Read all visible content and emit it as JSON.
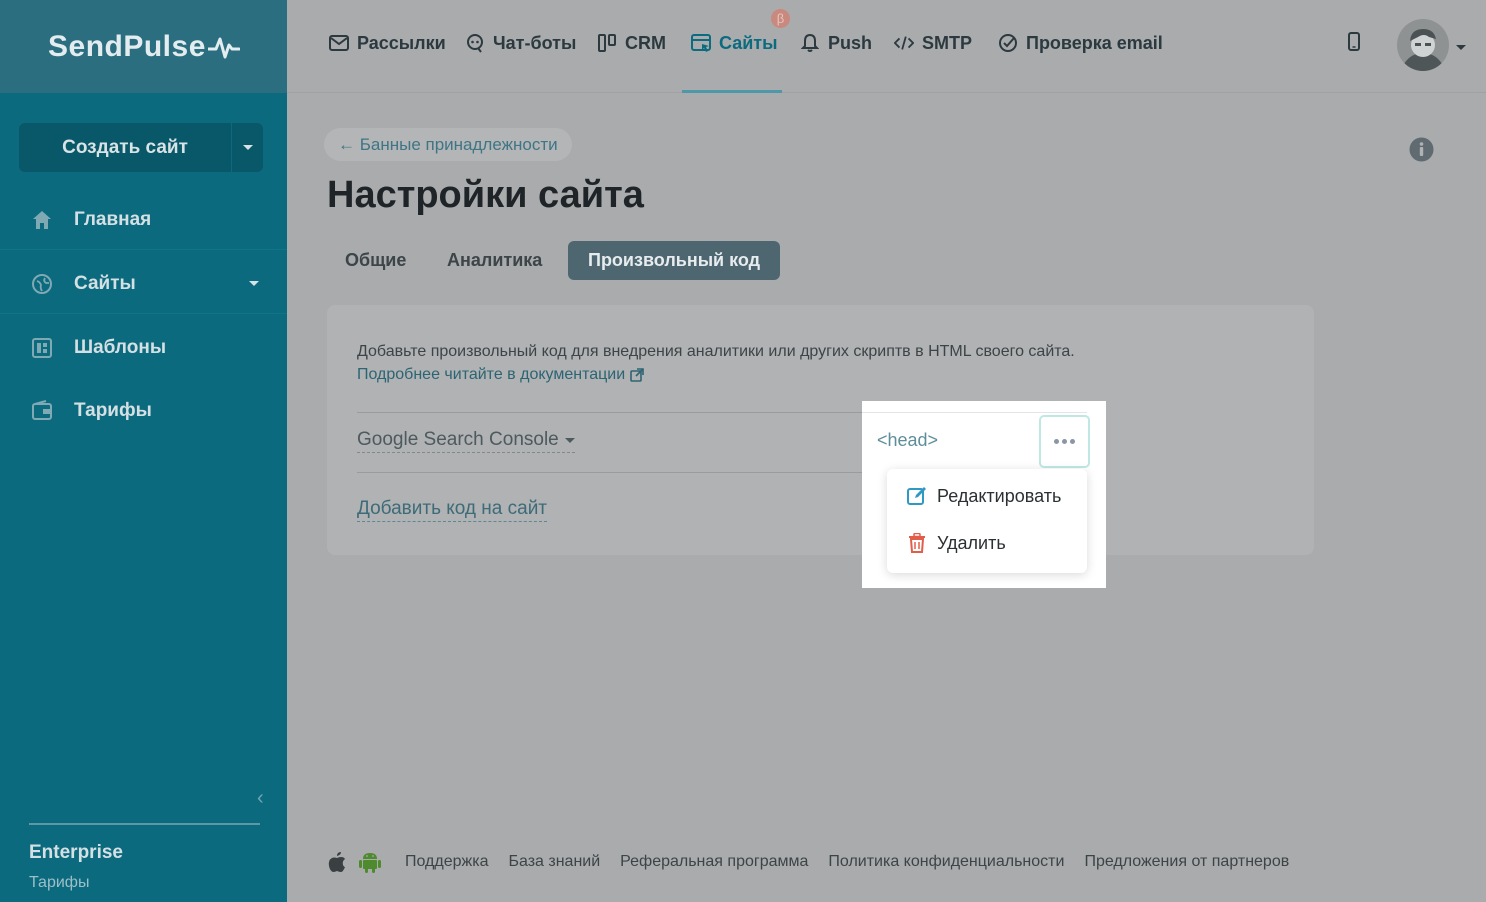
{
  "brand": {
    "name": "SendPulse"
  },
  "sidebar": {
    "create_button": "Создать сайт",
    "items": [
      {
        "label": "Главная",
        "icon": "home-icon"
      },
      {
        "label": "Сайты",
        "icon": "globe-icon"
      },
      {
        "label": "Шаблоны",
        "icon": "template-icon"
      },
      {
        "label": "Тарифы",
        "icon": "wallet-icon"
      }
    ],
    "plan_name": "Enterprise",
    "plan_link": "Тарифы"
  },
  "topnav": {
    "items": [
      {
        "label": "Рассылки",
        "icon": "mail-icon"
      },
      {
        "label": "Чат-боты",
        "icon": "chatbot-icon"
      },
      {
        "label": "CRM",
        "icon": "crm-icon"
      },
      {
        "label": "Сайты",
        "icon": "site-icon",
        "active": true
      },
      {
        "label": "Push",
        "icon": "bell-icon"
      },
      {
        "label": "SMTP",
        "icon": "code-icon"
      },
      {
        "label": "Проверка email",
        "icon": "check-circle-icon"
      }
    ],
    "beta_badge": "β"
  },
  "page": {
    "back_link": "← Банные принадлежности",
    "title": "Настройки сайта",
    "tabs": [
      "Общие",
      "Аналитика",
      "Произвольный код"
    ],
    "active_tab": "Произвольный код"
  },
  "custom_code": {
    "description": "Добавьте произвольный код для внедрения аналитики или других скриптв в HTML своего сайта.",
    "doc_link": "Подробнее читайте в документации",
    "entries": [
      {
        "name": "Google Search Console",
        "location": "<head>"
      }
    ],
    "add_link": "Добавить код на сайт"
  },
  "menu": {
    "items": [
      {
        "label": "Редактировать",
        "icon": "edit-icon"
      },
      {
        "label": "Удалить",
        "icon": "trash-icon"
      }
    ]
  },
  "footer": {
    "links": [
      "Поддержка",
      "База знаний",
      "Реферальная программа",
      "Политика конфиденциальности",
      "Предложения от партнеров"
    ]
  },
  "colors": {
    "sidebar": "#0b6a7e",
    "accent": "#0d6b80",
    "overlay": "#a9abac",
    "delete": "#e35d4b",
    "edit": "#2e9ac3"
  }
}
